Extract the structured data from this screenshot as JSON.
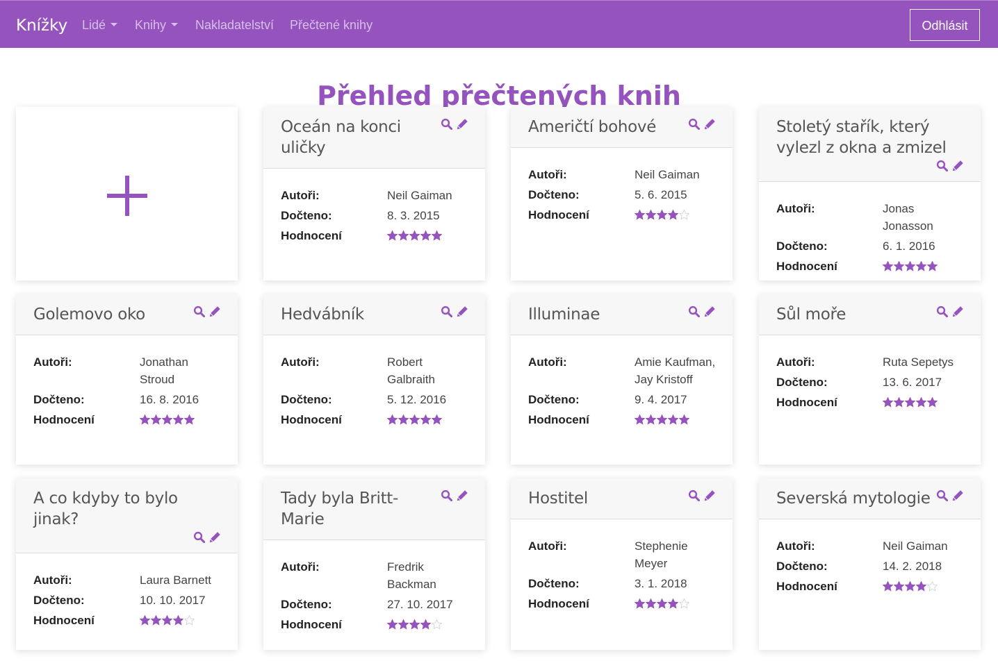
{
  "nav": {
    "brand": "Knížky",
    "items": [
      {
        "label": "Lidé",
        "dropdown": true
      },
      {
        "label": "Knihy",
        "dropdown": true
      },
      {
        "label": "Nakladatelství",
        "dropdown": false
      },
      {
        "label": "Přečtené knihy",
        "dropdown": false
      }
    ],
    "logout": "Odhlásit"
  },
  "page": {
    "title": "Přehled přečtených knih"
  },
  "labels": {
    "authors": "Autoři:",
    "finished": "Dočteno:",
    "rating": "Hodnocení"
  },
  "colors": {
    "accent": "#9553bd",
    "nav_text": "#d7bfe9",
    "card_header_bg": "#f7f7f7"
  },
  "icons": {
    "add": "plus-icon",
    "detail": "search-icon",
    "edit": "pencil-icon",
    "rating": "star-icon"
  },
  "rating_max": 5,
  "books": [
    {
      "title": "Oceán na konci uličky",
      "authors": "Neil Gaiman",
      "finished": "8. 3. 2015",
      "rating": 5
    },
    {
      "title": "Američtí bohové",
      "authors": "Neil Gaiman",
      "finished": "5. 6. 2015",
      "rating": 4
    },
    {
      "title": "Stoletý stařík, který vylezl z okna a zmizel",
      "authors": "Jonas Jonasson",
      "finished": "6. 1. 2016",
      "rating": 5
    },
    {
      "title": "Golemovo oko",
      "authors": "Jonathan Stroud",
      "finished": "16. 8. 2016",
      "rating": 5
    },
    {
      "title": "Hedvábník",
      "authors": "Robert Galbraith",
      "finished": "5. 12. 2016",
      "rating": 5
    },
    {
      "title": "Illuminae",
      "authors": "Amie Kaufman, Jay Kristoff",
      "finished": "9. 4. 2017",
      "rating": 5
    },
    {
      "title": "Sůl moře",
      "authors": "Ruta Sepetys",
      "finished": "13. 6. 2017",
      "rating": 5
    },
    {
      "title": "A co kdyby to bylo jinak?",
      "authors": "Laura Barnett",
      "finished": "10. 10. 2017",
      "rating": 4
    },
    {
      "title": "Tady byla Britt-Marie",
      "authors": "Fredrik Backman",
      "finished": "27. 10. 2017",
      "rating": 4
    },
    {
      "title": "Hostitel",
      "authors": "Stephenie Meyer",
      "finished": "3. 1. 2018",
      "rating": 4
    },
    {
      "title": "Severská mytologie",
      "authors": "Neil Gaiman",
      "finished": "14. 2. 2018",
      "rating": 4
    }
  ]
}
